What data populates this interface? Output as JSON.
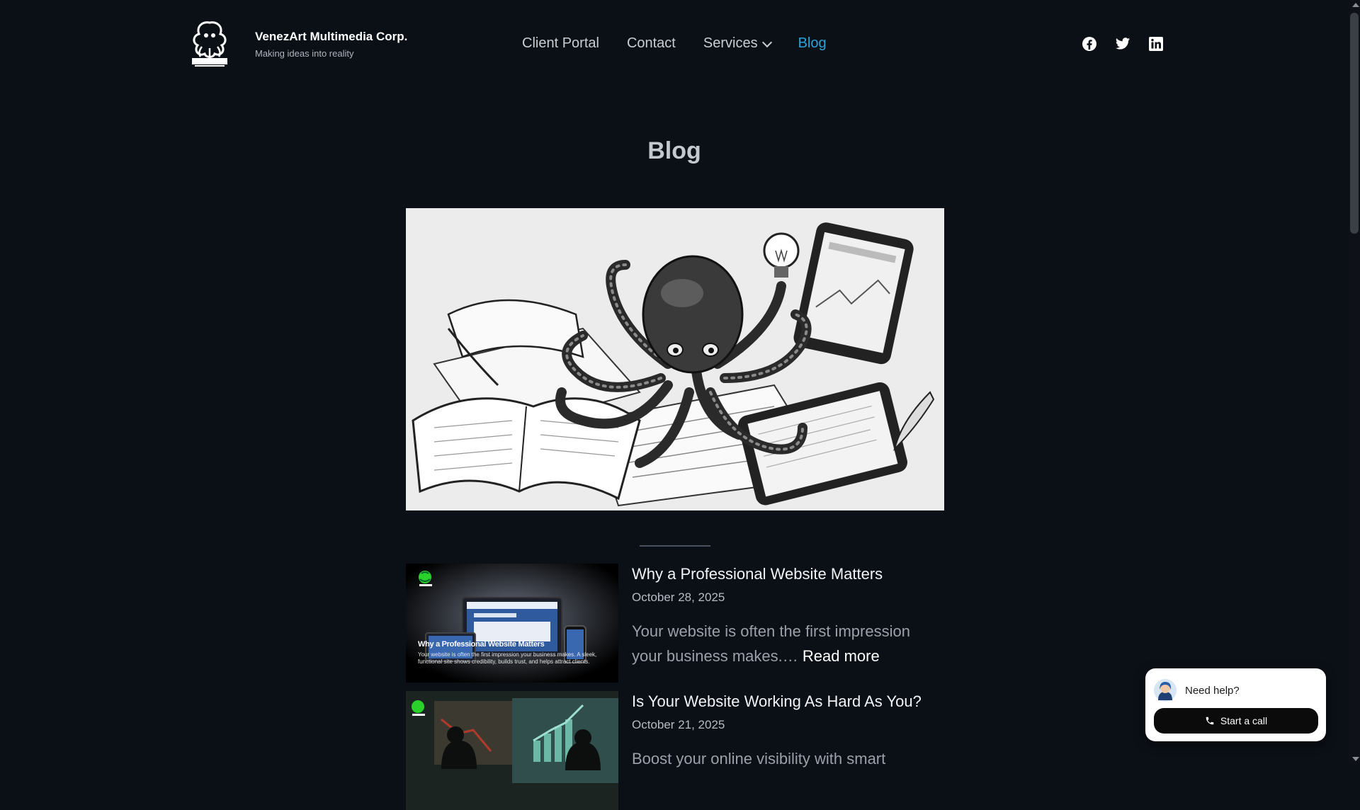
{
  "header": {
    "brand_name": "VenezArt Multimedia Corp.",
    "tagline": "Making ideas into reality",
    "nav": [
      {
        "label": "Client Portal"
      },
      {
        "label": "Contact"
      },
      {
        "label": "Services"
      },
      {
        "label": "Blog",
        "active": true
      }
    ],
    "social_icons": [
      "facebook-icon",
      "twitter-icon",
      "linkedin-icon"
    ]
  },
  "page": {
    "title": "Blog"
  },
  "posts": [
    {
      "title": "Why a Professional Website Matters",
      "date": "October 28, 2025",
      "excerpt": "Your website is often the first impression your business makes.…",
      "read_more": "Read more",
      "thumb_heading": "Why a Professional Website Matters",
      "thumb_text": "Your website is often the first impression your business makes. A sleek, functional site shows credibility, builds trust, and helps attract clients."
    },
    {
      "title": "Is Your Website Working As Hard As You?",
      "date": "October 21, 2025",
      "excerpt": "Boost your online visibility with smart"
    }
  ],
  "help_widget": {
    "prompt": "Need help?",
    "button_label": "Start a call"
  },
  "colors": {
    "background": "#0b0f16",
    "accent": "#2ba3d8",
    "text": "#d8dde4"
  }
}
